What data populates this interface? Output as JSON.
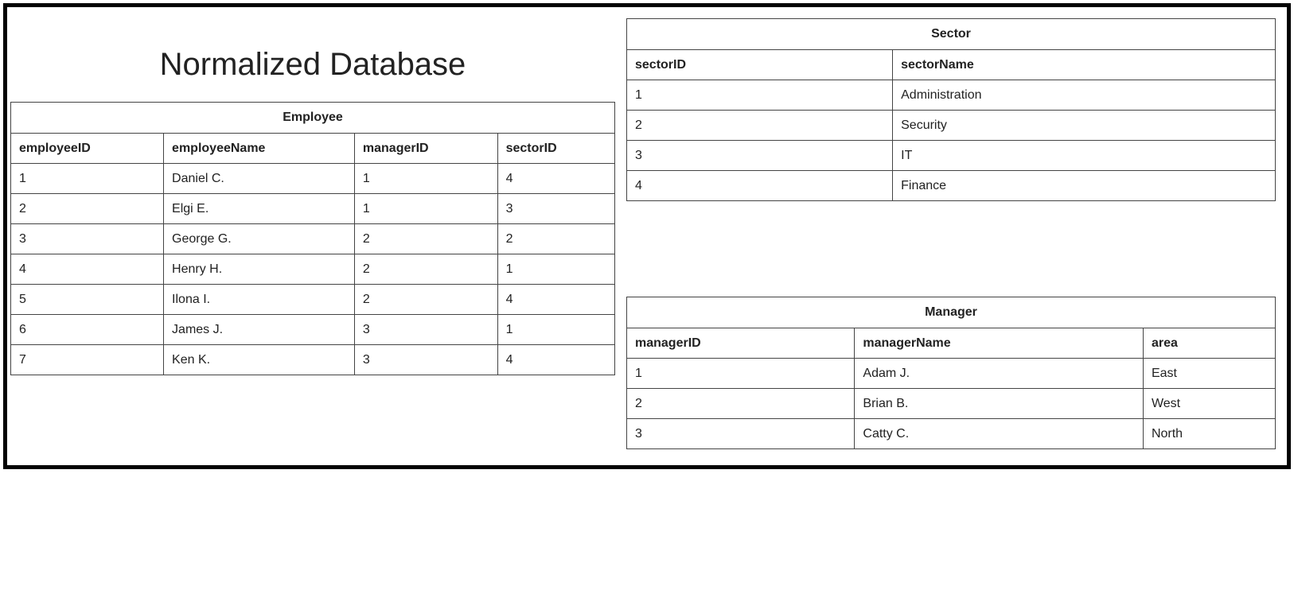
{
  "title": "Normalized Database",
  "employee": {
    "caption": "Employee",
    "headers": [
      "employeeID",
      "employeeName",
      "managerID",
      "sectorID"
    ],
    "rows": [
      [
        "1",
        "Daniel C.",
        "1",
        "4"
      ],
      [
        "2",
        "Elgi E.",
        "1",
        "3"
      ],
      [
        "3",
        "George G.",
        "2",
        "2"
      ],
      [
        "4",
        "Henry H.",
        "2",
        "1"
      ],
      [
        "5",
        "Ilona I.",
        "2",
        "4"
      ],
      [
        "6",
        "James J.",
        "3",
        "1"
      ],
      [
        "7",
        "Ken K.",
        "3",
        "4"
      ]
    ]
  },
  "sector": {
    "caption": "Sector",
    "headers": [
      "sectorID",
      "sectorName"
    ],
    "rows": [
      [
        "1",
        "Administration"
      ],
      [
        "2",
        "Security"
      ],
      [
        "3",
        "IT"
      ],
      [
        "4",
        "Finance"
      ]
    ]
  },
  "manager": {
    "caption": "Manager",
    "headers": [
      "managerID",
      "managerName",
      "area"
    ],
    "rows": [
      [
        "1",
        "Adam J.",
        "East"
      ],
      [
        "2",
        "Brian B.",
        "West"
      ],
      [
        "3",
        "Catty C.",
        "North"
      ]
    ]
  }
}
